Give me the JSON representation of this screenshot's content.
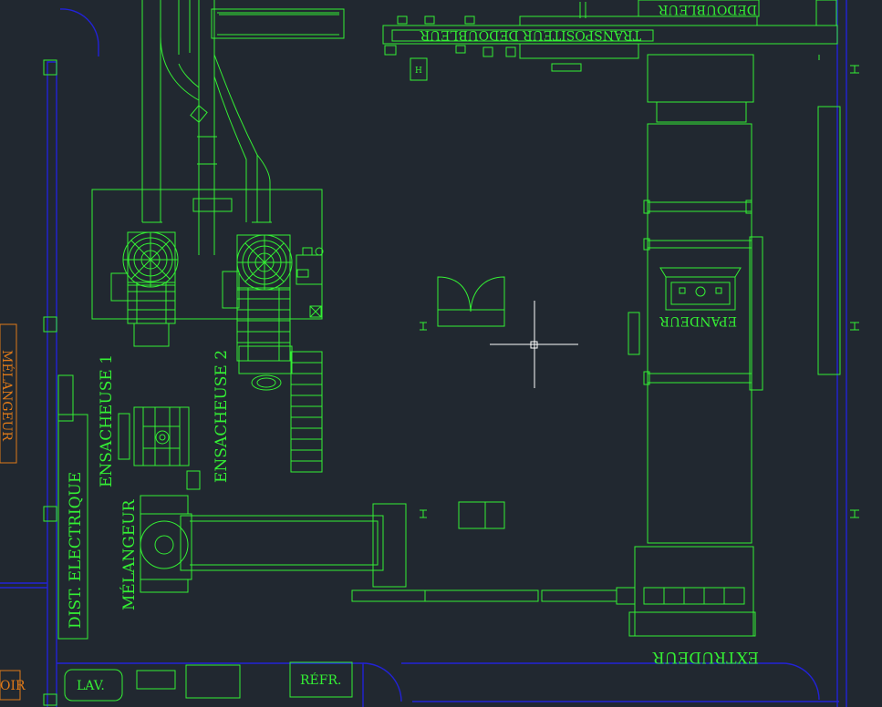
{
  "colors": {
    "background": "#212830",
    "equipment": "#34f034",
    "walls": "#2222d8",
    "external": "#e07a18",
    "crosshair": "#ffffff"
  },
  "labels": {
    "dedoubleur": "DEDOUBLEUR",
    "transpositeur": "TRANSPOSITEUR DEDOUBLEUR",
    "ensacheuse1": "ENSACHEUSE 1",
    "ensacheuse2": "ENSACHEUSE 2",
    "melangeur": "MÉLANGEUR",
    "melangeur_ext": "MÉLANGEUR",
    "dist_electrique": "DIST. ELECTRIQUE",
    "epandeur": "EPANDEUR",
    "extrudeur": "EXTRUDEUR",
    "lav": "LAV.",
    "refr": "RÉFR.",
    "oir": "OIR",
    "h_tag": "H"
  },
  "cursor": {
    "type": "crosshair"
  }
}
